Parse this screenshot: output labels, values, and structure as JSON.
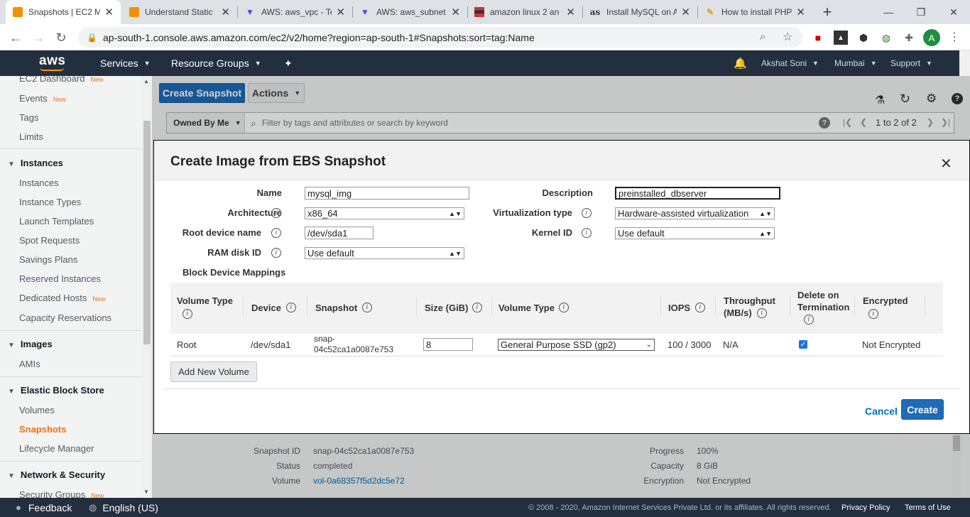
{
  "browser": {
    "tabs": [
      {
        "title": "Snapshots | EC2 M",
        "icon": "aws-cube-icon",
        "active": true
      },
      {
        "title": "Understand Static",
        "icon": "aws-cube-icon"
      },
      {
        "title": "AWS: aws_vpc - Te",
        "icon": "terraform-icon"
      },
      {
        "title": "AWS: aws_subnet",
        "icon": "terraform-icon"
      },
      {
        "title": "amazon linux 2 an",
        "icon": "site-icon"
      },
      {
        "title": "Install MySQL on A",
        "icon": "as-icon"
      },
      {
        "title": "How to install PHP",
        "icon": "site-icon"
      }
    ],
    "new_tab": "+",
    "url": "ap-south-1.console.aws.amazon.com/ec2/v2/home?region=ap-south-1#Snapshots:sort=tag:Name",
    "profile_initial": "A",
    "extension_badge": "1"
  },
  "awsnav": {
    "logo": "aws",
    "services": "Services",
    "resource_groups": "Resource Groups",
    "user": "Akshat Soni",
    "region": "Mumbai",
    "support": "Support"
  },
  "sidebar": {
    "top_items": [
      {
        "label": "EC2 Dashboard",
        "tag": "New"
      },
      {
        "label": "Events",
        "tag": "New"
      },
      {
        "label": "Tags"
      },
      {
        "label": "Limits"
      }
    ],
    "sections": [
      {
        "title": "Instances",
        "items": [
          {
            "label": "Instances"
          },
          {
            "label": "Instance Types"
          },
          {
            "label": "Launch Templates"
          },
          {
            "label": "Spot Requests"
          },
          {
            "label": "Savings Plans"
          },
          {
            "label": "Reserved Instances"
          },
          {
            "label": "Dedicated Hosts",
            "tag": "New"
          },
          {
            "label": "Capacity Reservations"
          }
        ]
      },
      {
        "title": "Images",
        "items": [
          {
            "label": "AMIs"
          }
        ]
      },
      {
        "title": "Elastic Block Store",
        "items": [
          {
            "label": "Volumes"
          },
          {
            "label": "Snapshots",
            "active": true
          },
          {
            "label": "Lifecycle Manager"
          }
        ]
      },
      {
        "title": "Network & Security",
        "items": [
          {
            "label": "Security Groups",
            "tag": "New"
          }
        ]
      }
    ]
  },
  "main": {
    "create_snapshot": "Create Snapshot",
    "actions": "Actions",
    "owned_by": "Owned By Me",
    "filter_placeholder": "Filter by tags and attributes or search by keyword",
    "pagination": "1 to 2 of 2"
  },
  "modal": {
    "title": "Create Image from EBS Snapshot",
    "fields": {
      "name_label": "Name",
      "name_value": "mysql_img",
      "description_label": "Description",
      "description_value": "preinstalled_dbserver",
      "architecture_label": "Architecture",
      "architecture_value": "x86_64",
      "virtualization_label": "Virtualization type",
      "virtualization_value": "Hardware-assisted virtualization",
      "root_device_label": "Root device name",
      "root_device_value": "/dev/sda1",
      "kernel_label": "Kernel ID",
      "kernel_value": "Use default",
      "ramdisk_label": "RAM disk ID",
      "ramdisk_value": "Use default"
    },
    "bdm_title": "Block Device Mappings",
    "bdm_columns": {
      "volume_type_1": "Volume Type",
      "device": "Device",
      "snapshot": "Snapshot",
      "size": "Size (GiB)",
      "volume_type_2": "Volume Type",
      "iops": "IOPS",
      "throughput_1": "Throughput",
      "throughput_2": "(MB/s)",
      "delete_1": "Delete on",
      "delete_2": "Termination",
      "encrypted": "Encrypted"
    },
    "bdm_row": {
      "volume_type": "Root",
      "device": "/dev/sda1",
      "snapshot_1": "snap-",
      "snapshot_2": "04c52ca1a0087e753",
      "size": "8",
      "ebs_type": "General Purpose SSD (gp2)",
      "iops": "100 / 3000",
      "throughput": "N/A",
      "delete_on_termination": true,
      "encrypted": "Not Encrypted"
    },
    "add_volume": "Add New Volume",
    "cancel": "Cancel",
    "create": "Create"
  },
  "details": {
    "snapshot_id_label": "Snapshot ID",
    "snapshot_id": "snap-04c52ca1a0087e753",
    "status_label": "Status",
    "status": "completed",
    "volume_label": "Volume",
    "volume": "vol-0a68357f5d2dc5e72",
    "progress_label": "Progress",
    "progress": "100%",
    "capacity_label": "Capacity",
    "capacity": "8 GiB",
    "encryption_label": "Encryption",
    "encryption": "Not Encrypted"
  },
  "footer": {
    "feedback": "Feedback",
    "language": "English (US)",
    "copyright": "© 2008 - 2020, Amazon Internet Services Private Ltd. or its affiliates. All rights reserved.",
    "privacy": "Privacy Policy",
    "terms": "Terms of Use"
  },
  "colors": {
    "aws_nav": "#232f3e",
    "primary_button": "#1e6bb8",
    "active_link": "#ec7211",
    "new_tag": "#ec7211"
  }
}
